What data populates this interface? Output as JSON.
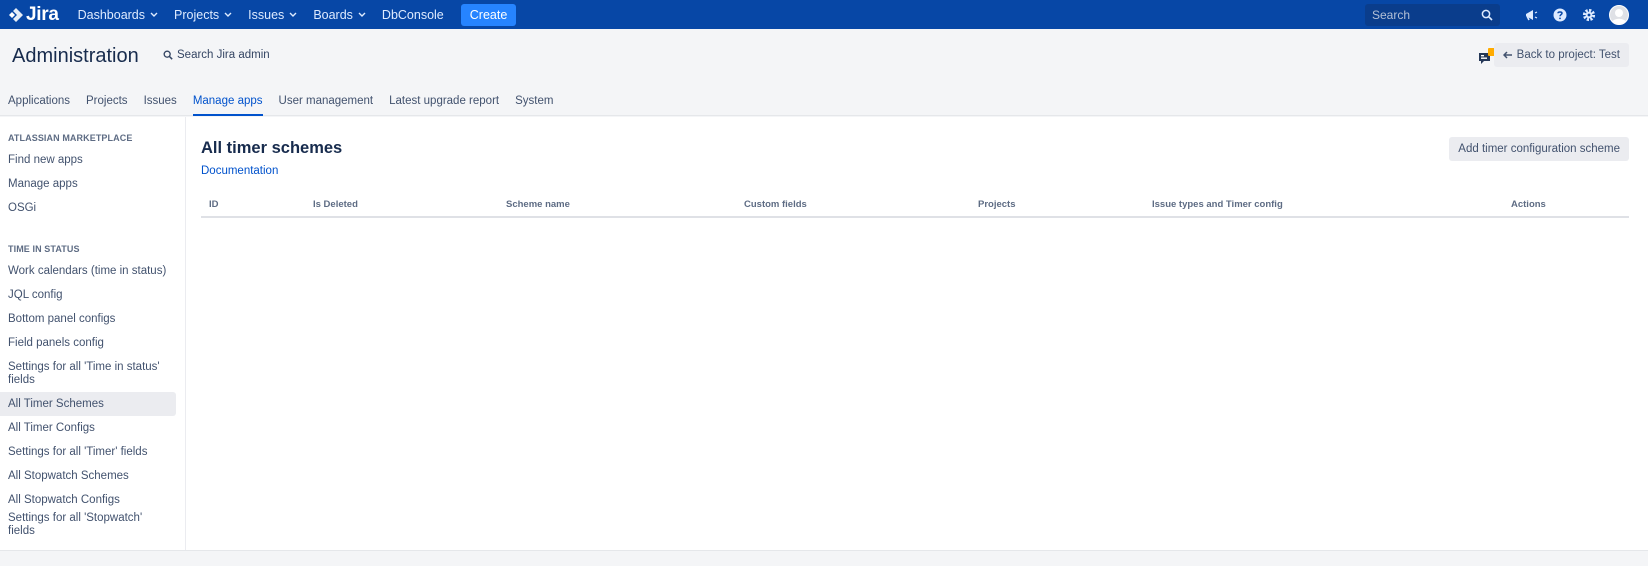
{
  "topnav": {
    "logo_text": "Jira",
    "items": [
      {
        "label": "Dashboards"
      },
      {
        "label": "Projects"
      },
      {
        "label": "Issues"
      },
      {
        "label": "Boards"
      },
      {
        "label": "DbConsole"
      }
    ],
    "create_label": "Create",
    "search_placeholder": "Search"
  },
  "admin": {
    "title": "Administration",
    "search_label": "Search Jira admin",
    "back_label": "Back to project: Test",
    "notification_count": "1",
    "tabs": [
      {
        "label": "Applications"
      },
      {
        "label": "Projects"
      },
      {
        "label": "Issues"
      },
      {
        "label": "Manage apps",
        "active": true
      },
      {
        "label": "User management"
      },
      {
        "label": "Latest upgrade report"
      },
      {
        "label": "System"
      }
    ]
  },
  "sidebar": {
    "sections": [
      {
        "title": "ATLASSIAN MARKETPLACE",
        "items": [
          {
            "label": "Find new apps"
          },
          {
            "label": "Manage apps"
          },
          {
            "label": "OSGi"
          }
        ]
      },
      {
        "title": "TIME IN STATUS",
        "items": [
          {
            "label": "Work calendars (time in status)"
          },
          {
            "label": "JQL config"
          },
          {
            "label": "Bottom panel configs"
          },
          {
            "label": "Field panels config"
          },
          {
            "label": "Settings for all 'Time in status' fields"
          },
          {
            "label": "All Timer Schemes",
            "selected": true
          },
          {
            "label": "All Timer Configs"
          },
          {
            "label": "Settings for all 'Timer' fields"
          },
          {
            "label": "All Stopwatch Schemes"
          },
          {
            "label": "All Stopwatch Configs"
          },
          {
            "label": "Settings for all 'Stopwatch' fields"
          }
        ]
      }
    ]
  },
  "main": {
    "title": "All timer schemes",
    "doc_link": "Documentation",
    "add_button": "Add timer configuration scheme",
    "columns": [
      "ID",
      "Is Deleted",
      "Scheme name",
      "Custom fields",
      "Projects",
      "Issue types and Timer config",
      "Actions"
    ]
  },
  "colors": {
    "nav_bg": "#0747a6",
    "create_bg": "#2684ff",
    "link": "#0052cc",
    "badge": "#ffab00"
  }
}
